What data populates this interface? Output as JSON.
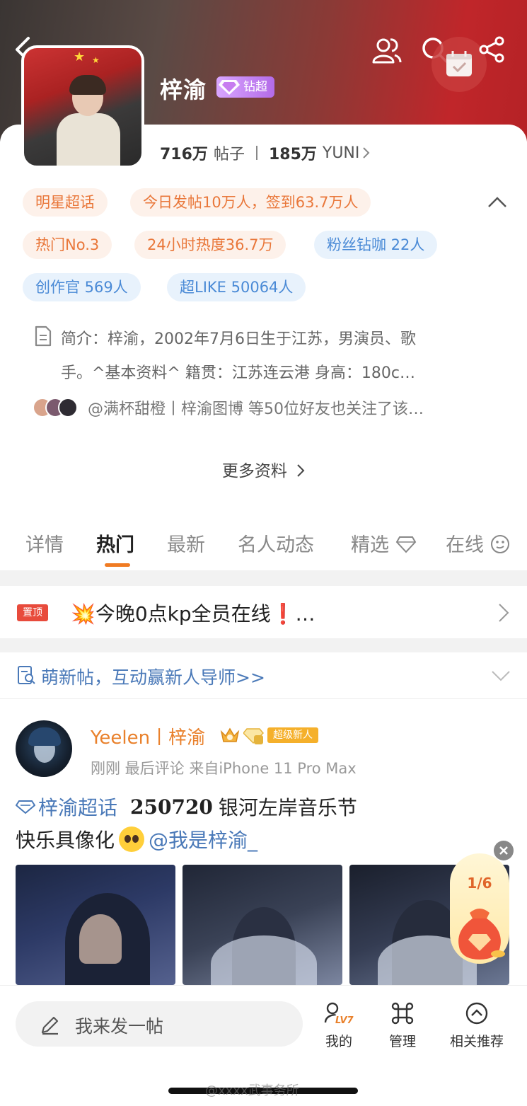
{
  "header": {
    "title": "梓渝",
    "badge": "钻超"
  },
  "stats": {
    "posts_count": "716万",
    "posts_label": "帖子",
    "fans_count": "185万",
    "fans_label": "YUNI"
  },
  "tags": [
    {
      "label": "明星超话",
      "style": "orange"
    },
    {
      "label": "今日发帖10万人，签到63.7万人",
      "style": "orange"
    },
    {
      "label": "热门No.3",
      "style": "orange"
    },
    {
      "label": "24小时热度36.7万",
      "style": "orange"
    },
    {
      "label": "粉丝钻咖 22人",
      "style": "blue"
    },
    {
      "label": "创作官 569人",
      "style": "blue"
    },
    {
      "label": "超LIKE 50064人",
      "style": "blue"
    }
  ],
  "intro": {
    "line1": "简介：梓渝，2002年7月6日生于江苏，男演员、歌",
    "line2": "手。^基本资料^  籍贯：江苏连云港  身高：180c…"
  },
  "friends_text": "@满杯甜橙丨梓渝图博 等50位好友也关注了该…",
  "more_label": "更多资料",
  "tabs": [
    {
      "label": "详情"
    },
    {
      "label": "热门"
    },
    {
      "label": "最新"
    },
    {
      "label": "名人动态"
    },
    {
      "label": "精选"
    },
    {
      "label": "在线"
    }
  ],
  "pinned": {
    "badge": "置顶",
    "text": "💥今晚0点kp全员在线❗…"
  },
  "newbie": {
    "text": "萌新帖，互动赢新人导师>>"
  },
  "post": {
    "author": "Yeelen丨梓渝",
    "author_badge": "超级新人",
    "meta": "刚刚 最后评论  来自iPhone 11 Pro Max",
    "topic": "梓渝超话",
    "date": "250720",
    "event": "银河左岸音乐节",
    "line2_text": "快乐具像化",
    "mention": "@我是梓渝_"
  },
  "floating": {
    "count": "1/6"
  },
  "bottom": {
    "compose_placeholder": "我来发一帖",
    "level_badge": "LV7",
    "mine_label": "我的",
    "manage_label": "管理",
    "related_label": "相关推荐"
  },
  "watermark": "@xxxx武事务所",
  "colors": {
    "accent_orange": "#e9773a",
    "accent_blue": "#4a8ad6",
    "link_blue": "#4a79b8",
    "tab_underline": "#f07b22"
  }
}
